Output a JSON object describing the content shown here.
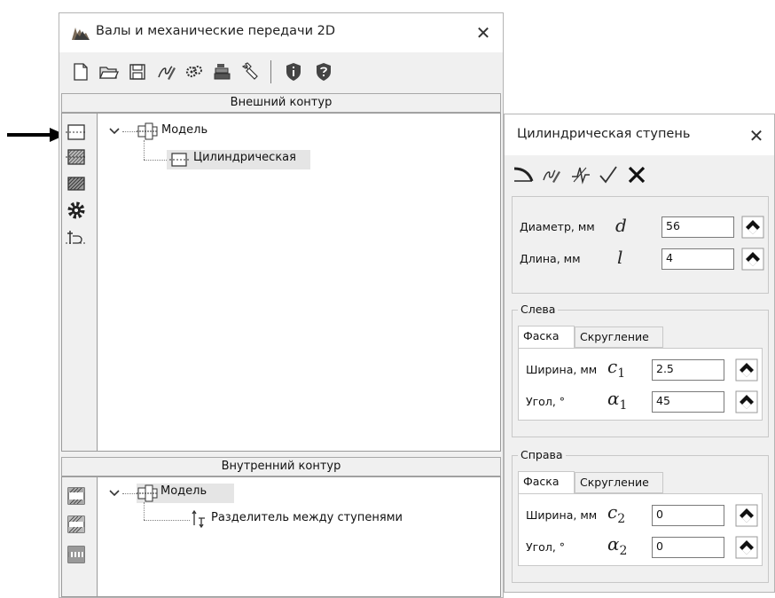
{
  "main_window": {
    "title": "Валы и механические передачи 2D",
    "close_glyph": "✕"
  },
  "outer_contour": {
    "header": "Внешний контур",
    "tree": {
      "root_label": "Модель",
      "child_label": "Цилиндрическая"
    }
  },
  "inner_contour": {
    "header": "Внутренний контур",
    "tree": {
      "root_label": "Модель",
      "child_label": "Разделитель между ступенями"
    }
  },
  "dialog": {
    "title": "Цилиндрическая ступень",
    "close_glyph": "✕",
    "diameter": {
      "label": "Диаметр, мм",
      "symbol": "d",
      "value": "56"
    },
    "length": {
      "label": "Длина, мм",
      "symbol": "l",
      "value": "4"
    },
    "left": {
      "title": "Слева",
      "tabs": [
        "Фаска",
        "Скругление"
      ],
      "width": {
        "label": "Ширина, мм",
        "symbol": "c",
        "sub": "1",
        "value": "2.5"
      },
      "angle": {
        "label": "Угол, °",
        "symbol": "α",
        "sub": "1",
        "value": "45"
      }
    },
    "right": {
      "title": "Справа",
      "tabs": [
        "Фаска",
        "Скругление"
      ],
      "width": {
        "label": "Ширина, мм",
        "symbol": "c",
        "sub": "2",
        "value": "0"
      },
      "angle": {
        "label": "Угол, °",
        "symbol": "α",
        "sub": "2",
        "value": "0"
      }
    }
  },
  "icons": {
    "toolbar": [
      "new-document-icon",
      "open-folder-icon",
      "save-icon",
      "edit-icon",
      "gears-icon",
      "gear-stack-icon",
      "wrench-icon",
      "shield-info-icon",
      "shield-help-icon"
    ],
    "outer_side": [
      "cylinder-step-icon",
      "hatched-step-icon",
      "hatched-cone-icon",
      "gear-icon",
      "add-element-icon"
    ],
    "inner_side": [
      "bore-step-icon",
      "hatched-bore-icon",
      "splined-bore-icon"
    ],
    "dialog_toolbar": [
      "apply-icon",
      "edit-icon",
      "calculate-icon",
      "checkmark-icon",
      "delete-icon"
    ]
  },
  "colors": {
    "window_bg": "#f0f0f0",
    "selection": "#e5e5e5",
    "border": "#9a9a9a"
  }
}
